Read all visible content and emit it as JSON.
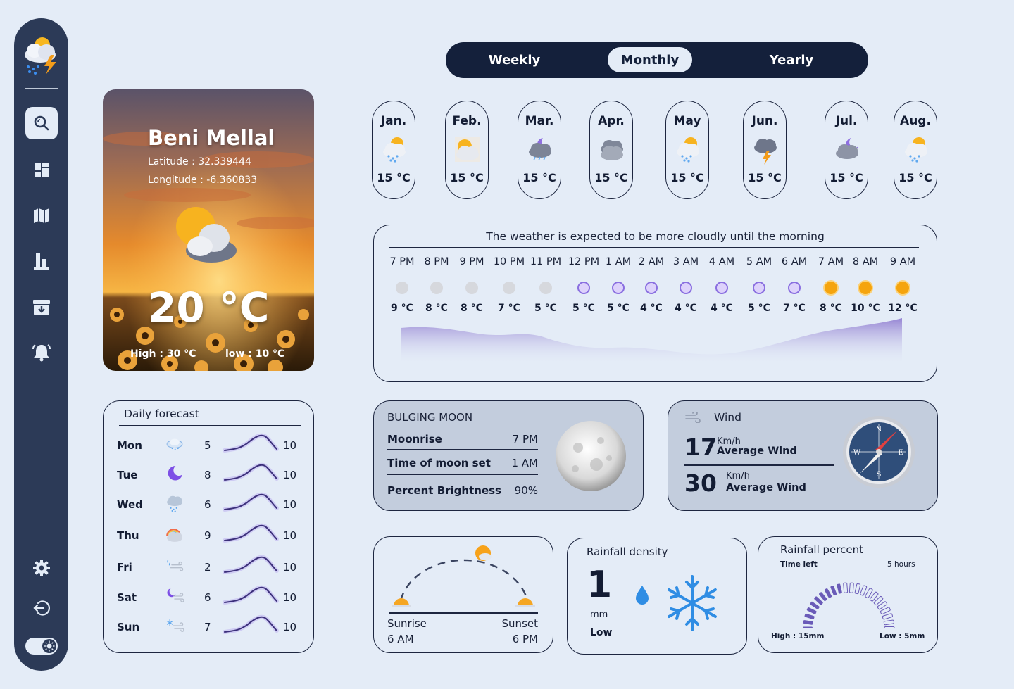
{
  "sidebar": {
    "items": [
      {
        "name": "search",
        "icon": "search-icon",
        "active": true
      },
      {
        "name": "dashboard",
        "icon": "dashboard-icon"
      },
      {
        "name": "map",
        "icon": "map-icon"
      },
      {
        "name": "stats",
        "icon": "bar-chart-icon"
      },
      {
        "name": "archive",
        "icon": "archive-icon"
      },
      {
        "name": "alerts",
        "icon": "bell-icon"
      }
    ],
    "bottom": [
      "gear-icon",
      "logout-icon",
      "theme-toggle"
    ]
  },
  "city": {
    "name": "Beni Mellal",
    "latitude": "Latitude : 32.339444",
    "longitude": "Longitude : -6.360833",
    "temp": "20 °C",
    "high": "High : 30 °C",
    "low": "low : 10 °C"
  },
  "tabs": {
    "weekly": "Weekly",
    "monthly": "Monthly",
    "yearly": "Yearly",
    "active": "Monthly"
  },
  "months": [
    {
      "label": "Jan.",
      "temp": "15 °C",
      "icon": "snow-sun-icon"
    },
    {
      "label": "Feb.",
      "temp": "15 °C",
      "icon": "sun-cloud-icon"
    },
    {
      "label": "Mar.",
      "temp": "15 °C",
      "icon": "night-rain-icon"
    },
    {
      "label": "Apr.",
      "temp": "15 °C",
      "icon": "clouds-icon"
    },
    {
      "label": "May",
      "temp": "15 °C",
      "icon": "snow-sun-icon"
    },
    {
      "label": "Jun.",
      "temp": "15 °C",
      "icon": "thunder-icon"
    },
    {
      "label": "Jul.",
      "temp": "15 °C",
      "icon": "moon-cloud-icon"
    },
    {
      "label": "Aug.",
      "temp": "15 °C",
      "icon": "snow-sun-icon"
    }
  ],
  "hourly": {
    "message": "The weather is expected to be more cloudly until the morning",
    "hours": [
      {
        "time": "7 PM",
        "temp": "9 °C",
        "kind": "grey"
      },
      {
        "time": "8 PM",
        "temp": "8 °C",
        "kind": "grey"
      },
      {
        "time": "9 PM",
        "temp": "8 °C",
        "kind": "grey"
      },
      {
        "time": "10 PM",
        "temp": "7 °C",
        "kind": "grey"
      },
      {
        "time": "11 PM",
        "temp": "5 °C",
        "kind": "grey"
      },
      {
        "time": "12 PM",
        "temp": "5 °C",
        "kind": "purple"
      },
      {
        "time": "1 AM",
        "temp": "5 °C",
        "kind": "purple"
      },
      {
        "time": "2 AM",
        "temp": "4 °C",
        "kind": "purple"
      },
      {
        "time": "3 AM",
        "temp": "4 °C",
        "kind": "purple"
      },
      {
        "time": "4 AM",
        "temp": "4 °C",
        "kind": "purple"
      },
      {
        "time": "5 AM",
        "temp": "5 °C",
        "kind": "purple"
      },
      {
        "time": "6 AM",
        "temp": "7 °C",
        "kind": "purple"
      },
      {
        "time": "7 AM",
        "temp": "8 °C",
        "kind": "orange"
      },
      {
        "time": "8 AM",
        "temp": "10 °C",
        "kind": "orange"
      },
      {
        "time": "9 AM",
        "temp": "12 °C",
        "kind": "orange"
      }
    ]
  },
  "daily": {
    "title": "Daily forecast",
    "days": [
      {
        "day": "Mon",
        "low": "5",
        "high": "10",
        "icon": "cloud-snow-icon"
      },
      {
        "day": "Tue",
        "low": "8",
        "high": "10",
        "icon": "moon-icon"
      },
      {
        "day": "Wed",
        "low": "6",
        "high": "10",
        "icon": "snow-cloud-icon"
      },
      {
        "day": "Thu",
        "low": "9",
        "high": "10",
        "icon": "rainbow-cloud-icon"
      },
      {
        "day": "Fri",
        "low": "2",
        "high": "10",
        "icon": "rain-wind-icon"
      },
      {
        "day": "Sat",
        "low": "6",
        "high": "10",
        "icon": "moon-wind-icon"
      },
      {
        "day": "Sun",
        "low": "7",
        "high": "10",
        "icon": "snowflake-wind-icon"
      }
    ]
  },
  "moon": {
    "title": "BULGING MOON",
    "moonrise_label": "Moonrise",
    "moonrise": "7 PM",
    "moonset_label": "Time of moon set",
    "moonset": "1 AM",
    "brightness_label": "Percent Brightness",
    "brightness": "90%"
  },
  "wind": {
    "title": "Wind",
    "v1": "17",
    "u1": "Km/h",
    "l1": "Average Wind",
    "v2": "30",
    "u2": "Km/h",
    "l2": "Average Wind"
  },
  "sun": {
    "sunrise_label": "Sunrise",
    "sunrise": "6 AM",
    "sunset_label": "Sunset",
    "sunset": "6 PM"
  },
  "rain": {
    "title": "Rainfall density",
    "value": "1",
    "unit": "mm",
    "level": "Low"
  },
  "rain_pct": {
    "title": "Rainfall percent",
    "time_left": "Time left",
    "hours": "5 hours",
    "high": "High : 15mm",
    "low": "Low : 5mm",
    "fill_fraction": 0.45
  },
  "colors": {
    "navy": "#14203b",
    "sidebar": "#2c3a57",
    "bg": "#e4ecf7",
    "purple": "#8a6fe0",
    "orange": "#f2a400"
  }
}
